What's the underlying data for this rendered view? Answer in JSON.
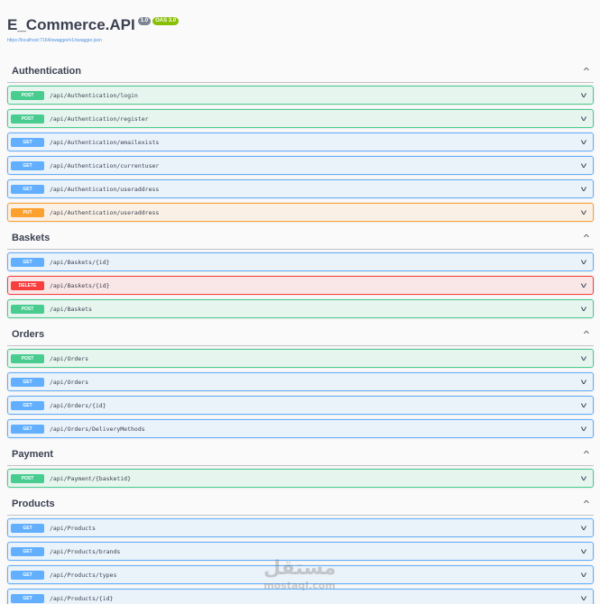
{
  "info": {
    "title": "E_Commerce.API",
    "version_badge": "1.0",
    "oas_badge": "OAS 3.0",
    "spec_link": "https://localhost:7164/swagger/v1/swagger.json"
  },
  "colors": {
    "post": "#49cc90",
    "get": "#61affe",
    "put": "#fca130",
    "delete": "#f93e3e"
  },
  "icons": {
    "collapse": "chevron-up-icon",
    "expand": "chevron-down-icon"
  },
  "tags": [
    {
      "name": "Authentication",
      "operations": [
        {
          "method": "POST",
          "path": "/api/Authentication/login"
        },
        {
          "method": "POST",
          "path": "/api/Authentication/register"
        },
        {
          "method": "GET",
          "path": "/api/Authentication/emailexists"
        },
        {
          "method": "GET",
          "path": "/api/Authentication/currentuser"
        },
        {
          "method": "GET",
          "path": "/api/Authentication/useraddress"
        },
        {
          "method": "PUT",
          "path": "/api/Authentication/useraddress"
        }
      ]
    },
    {
      "name": "Baskets",
      "operations": [
        {
          "method": "GET",
          "path": "/api/Baskets/{id}"
        },
        {
          "method": "DELETE",
          "path": "/api/Baskets/{id}"
        },
        {
          "method": "POST",
          "path": "/api/Baskets"
        }
      ]
    },
    {
      "name": "Orders",
      "operations": [
        {
          "method": "POST",
          "path": "/api/Orders"
        },
        {
          "method": "GET",
          "path": "/api/Orders"
        },
        {
          "method": "GET",
          "path": "/api/Orders/{id}"
        },
        {
          "method": "GET",
          "path": "/api/Orders/DeliveryMethods"
        }
      ]
    },
    {
      "name": "Payment",
      "operations": [
        {
          "method": "POST",
          "path": "/api/Payment/{basketid}"
        }
      ]
    },
    {
      "name": "Products",
      "operations": [
        {
          "method": "GET",
          "path": "/api/Products"
        },
        {
          "method": "GET",
          "path": "/api/Products/brands"
        },
        {
          "method": "GET",
          "path": "/api/Products/types"
        },
        {
          "method": "GET",
          "path": "/api/Products/{id}"
        }
      ]
    }
  ],
  "watermark": {
    "arabic": "مستقل",
    "latin": "mostaql.com"
  }
}
